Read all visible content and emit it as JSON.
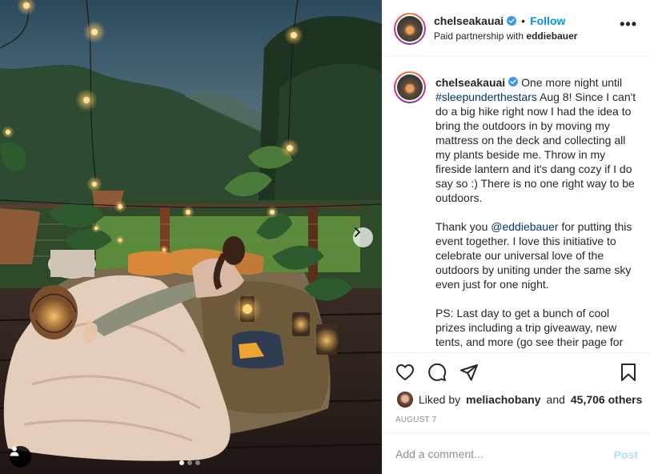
{
  "post": {
    "header": {
      "username": "chelseakauai",
      "separator": "•",
      "follow_label": "Follow",
      "partnership_prefix": "Paid partnership with",
      "partner": "eddiebauer",
      "more_label": "•••"
    },
    "caption": {
      "username": "chelseakauai",
      "part1_before_tag": "One more night until",
      "hashtag": "#sleepunderthestars",
      "part1_after_tag": "Aug 8! Since I can't do a big hike right now I had the idea to bring the outdoors in by moving my mattress on the deck and collecting all my plants beside me. Throw in my fireside lantern and it's dang cozy if I do say so :) There is no one right way to be outdoors.",
      "part2_before_mention": "Thank you",
      "mention": "@eddiebauer",
      "part2_after_mention": "for putting this event together. I love this initiative to celebrate our universal love of the outdoors by uniting under the same sky even just for one night.",
      "part3": "PS: Last day to get a bunch of cool prizes including a trip giveaway, new tents, and more (go see their page for"
    },
    "likes": {
      "prefix": "Liked by",
      "liker": "meliachobany",
      "conjunction": "and",
      "others": "45,706 others"
    },
    "date": "AUGUST 7",
    "comment_input": {
      "placeholder": "Add a comment..."
    },
    "post_label": "Post",
    "carousel": {
      "total": 3,
      "current": 1
    },
    "icons": [
      "heart-icon",
      "comment-icon",
      "share-icon",
      "bookmark-icon",
      "user-tag-icon",
      "chevron-right-icon",
      "verified-badge-icon"
    ],
    "colors": {
      "accent": "#0095f6",
      "link": "#00376b",
      "muted": "#8e8e8e",
      "post_disabled": "#b2dffc"
    }
  }
}
